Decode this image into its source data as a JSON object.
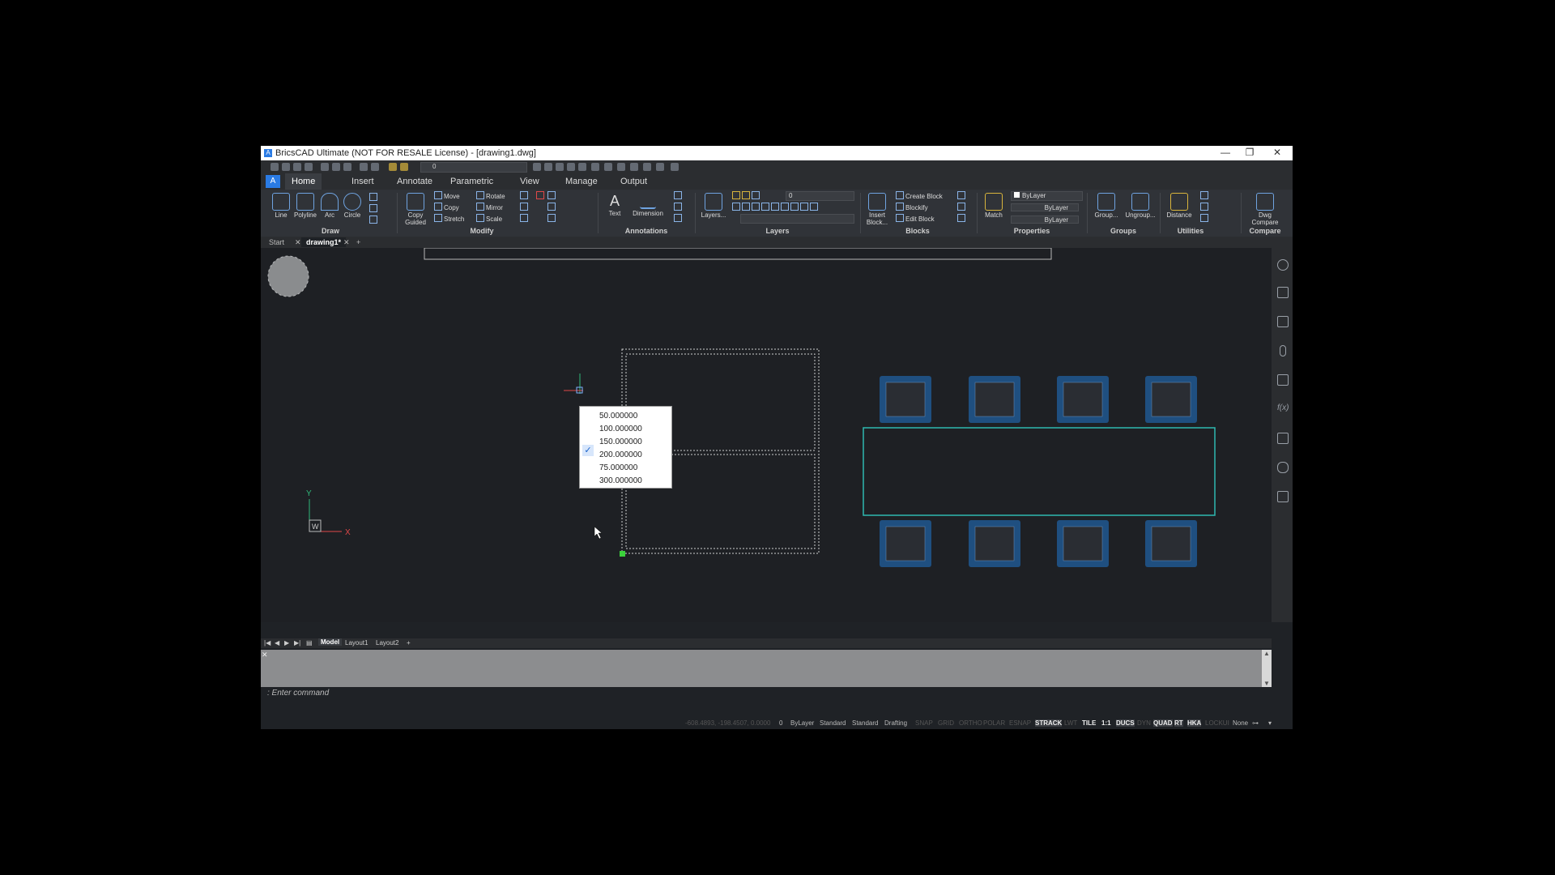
{
  "window": {
    "title": "BricsCAD Ultimate (NOT FOR RESALE License) - [drawing1.dwg]",
    "logo": "A",
    "controls": [
      "—",
      "❐",
      "✕"
    ]
  },
  "quick_access": {
    "layer_value": "0"
  },
  "ribbon_tabs": [
    "Home",
    "Insert",
    "Annotate",
    "Parametric",
    "View",
    "Manage",
    "Output"
  ],
  "active_tab": "Home",
  "ribbon": {
    "draw": {
      "name": "Draw",
      "line": "Line",
      "polyline": "Polyline",
      "arc": "Arc",
      "circle": "Circle"
    },
    "modify": {
      "name": "Modify",
      "copy_guided": "Copy Guided",
      "move": "Move",
      "copy": "Copy",
      "stretch": "Stretch",
      "rotate": "Rotate",
      "mirror": "Mirror",
      "scale": "Scale"
    },
    "annotations": {
      "name": "Annotations",
      "text": "Text",
      "dimension": "Dimension"
    },
    "layers": {
      "name": "Layers",
      "layers": "Layers...",
      "layer_value": "0"
    },
    "blocks": {
      "name": "Blocks",
      "insert": "Insert Block...",
      "create": "Create Block",
      "blockify": "Blockify",
      "edit": "Edit Block"
    },
    "properties": {
      "name": "Properties",
      "match": "Match",
      "bylayer1": "ByLayer",
      "bylayer2": "ByLayer",
      "bylayer3": "ByLayer"
    },
    "groups": {
      "name": "Groups",
      "group": "Group...",
      "ungroup": "Ungroup..."
    },
    "utilities": {
      "name": "Utilities",
      "distance": "Distance"
    },
    "compare": {
      "name": "Compare",
      "dwg_compare": "Dwg Compare"
    }
  },
  "doc_tabs": {
    "start": "Start",
    "drawing": "drawing1*",
    "add": "+"
  },
  "ucs": {
    "y": "Y",
    "x": "X",
    "w": "W"
  },
  "popup": {
    "options": [
      "50.000000",
      "100.000000",
      "150.000000",
      "200.000000",
      "75.000000",
      "300.000000"
    ],
    "checked_index": 3
  },
  "layout_tabs": {
    "model": "Model",
    "layout1": "Layout1",
    "layout2": "Layout2",
    "add": "+"
  },
  "command": {
    "prompt": ": Enter command"
  },
  "status": {
    "coords": "-608.4893, -198.4507, 0.0000",
    "layer": "0",
    "bylayer": "ByLayer",
    "standard1": "Standard",
    "standard2": "Standard",
    "drafting": "Drafting",
    "toggles": [
      {
        "label": "SNAP",
        "on": false
      },
      {
        "label": "GRID",
        "on": false
      },
      {
        "label": "ORTHO",
        "on": false
      },
      {
        "label": "POLAR",
        "on": false
      },
      {
        "label": "ESNAP",
        "on": false
      },
      {
        "label": "STRACK",
        "on": true
      },
      {
        "label": "LWT",
        "on": false
      },
      {
        "label": "TILE",
        "on": true
      },
      {
        "label": "1:1",
        "on": true
      },
      {
        "label": "DUCS",
        "on": true
      },
      {
        "label": "DYN",
        "on": false
      },
      {
        "label": "QUAD",
        "on": true
      },
      {
        "label": "RT",
        "on": true
      },
      {
        "label": "HKA",
        "on": true
      },
      {
        "label": "LOCKUI",
        "on": false
      }
    ],
    "none": "None"
  },
  "colors": {
    "accent": "#2a7be4",
    "chair": "#1f4f80",
    "table": "#2fb8b0",
    "selection": "#cccccc",
    "grip": "#3bd13b"
  }
}
